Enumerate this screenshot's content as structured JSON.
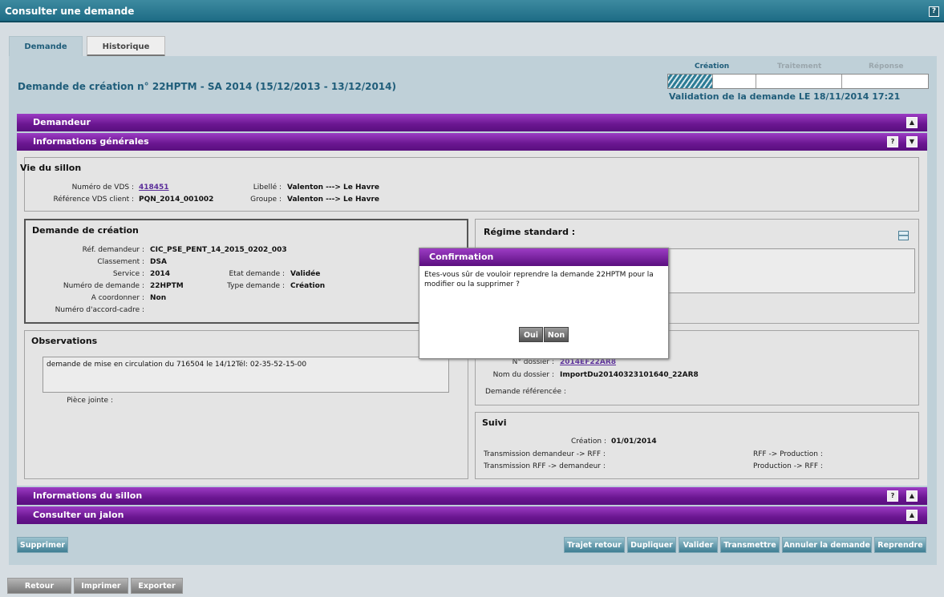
{
  "window": {
    "title": "Consulter une demande",
    "help": "?"
  },
  "tabs": [
    {
      "label": "Demande"
    },
    {
      "label": "Historique"
    }
  ],
  "demand_title": "Demande de création n° 22HPTM - SA 2014 (15/12/2013 - 13/12/2014)",
  "steps": {
    "labels": [
      "Création",
      "Traitement",
      "Réponse"
    ],
    "validation": "Validation de la demande LE 18/11/2014 17:21"
  },
  "sections": {
    "demandeur": "Demandeur",
    "informations_generales": "Informations générales",
    "informations_sillon": "Informations du sillon",
    "consulter_jalon": "Consulter un jalon"
  },
  "vie_sillon": {
    "title": "Vie du sillon",
    "numero_vds_label": "Numéro de VDS :",
    "numero_vds": "418451",
    "ref_vds_label": "Référence VDS client :",
    "ref_vds": "PQN_2014_001002",
    "libelle_label": "Libellé :",
    "libelle": "Valenton ---> Le Havre",
    "groupe_label": "Groupe :",
    "groupe": "Valenton ---> Le Havre"
  },
  "demande_creation": {
    "title": "Demande de création",
    "ref_label": "Réf. demandeur :",
    "ref": "CIC_PSE_PENT_14_2015_0202_003",
    "classement_label": "Classement :",
    "classement": "DSA",
    "service_label": "Service :",
    "service": "2014",
    "numero_label": "Numéro de demande :",
    "numero": "22HPTM",
    "coordonner_label": "A coordonner :",
    "coordonner": "Non",
    "accord_label": "Numéro d'accord-cadre :",
    "etat_label": "Etat demande :",
    "etat": "Validée",
    "type_label": "Type demande :",
    "type": "Création"
  },
  "regime": {
    "title": "Régime standard :"
  },
  "observations": {
    "title": "Observations",
    "text": "demande de mise en circulation du 716504 le 14/12Tél: 02-35-52-15-00",
    "piece_label": "Pièce jointe :"
  },
  "dossier": {
    "numero_label": "N° dossier :",
    "numero": "2014EF22AR8",
    "nom_label": "Nom du dossier :",
    "nom": "ImportDu20140323101640_22AR8",
    "referencee_label": "Demande référencée :"
  },
  "suivi": {
    "title": "Suivi",
    "creation_label": "Création :",
    "creation": "01/01/2014",
    "trans_dem_rff": "Transmission demandeur -> RFF :",
    "trans_rff_dem": "Transmission RFF -> demandeur :",
    "rff_prod": "RFF -> Production :",
    "prod_rff": "Production -> RFF :"
  },
  "dialog": {
    "title": "Confirmation",
    "message": "Etes-vous sûr de vouloir reprendre la demande 22HPTM pour la modifier ou la supprimer ?",
    "yes": "Oui",
    "no": "Non"
  },
  "actions": {
    "supprimer": "Supprimer",
    "trajet_retour": "Trajet retour",
    "dupliquer": "Dupliquer",
    "valider": "Valider",
    "transmettre": "Transmettre",
    "annuler": "Annuler la demande",
    "reprendre": "Reprendre"
  },
  "footer": {
    "retour": "Retour",
    "imprimer": "Imprimer",
    "exporter": "Exporter"
  },
  "colors": {
    "accent": "#1f5d7a",
    "section": "#6a1690",
    "link": "#5a2d9a"
  }
}
